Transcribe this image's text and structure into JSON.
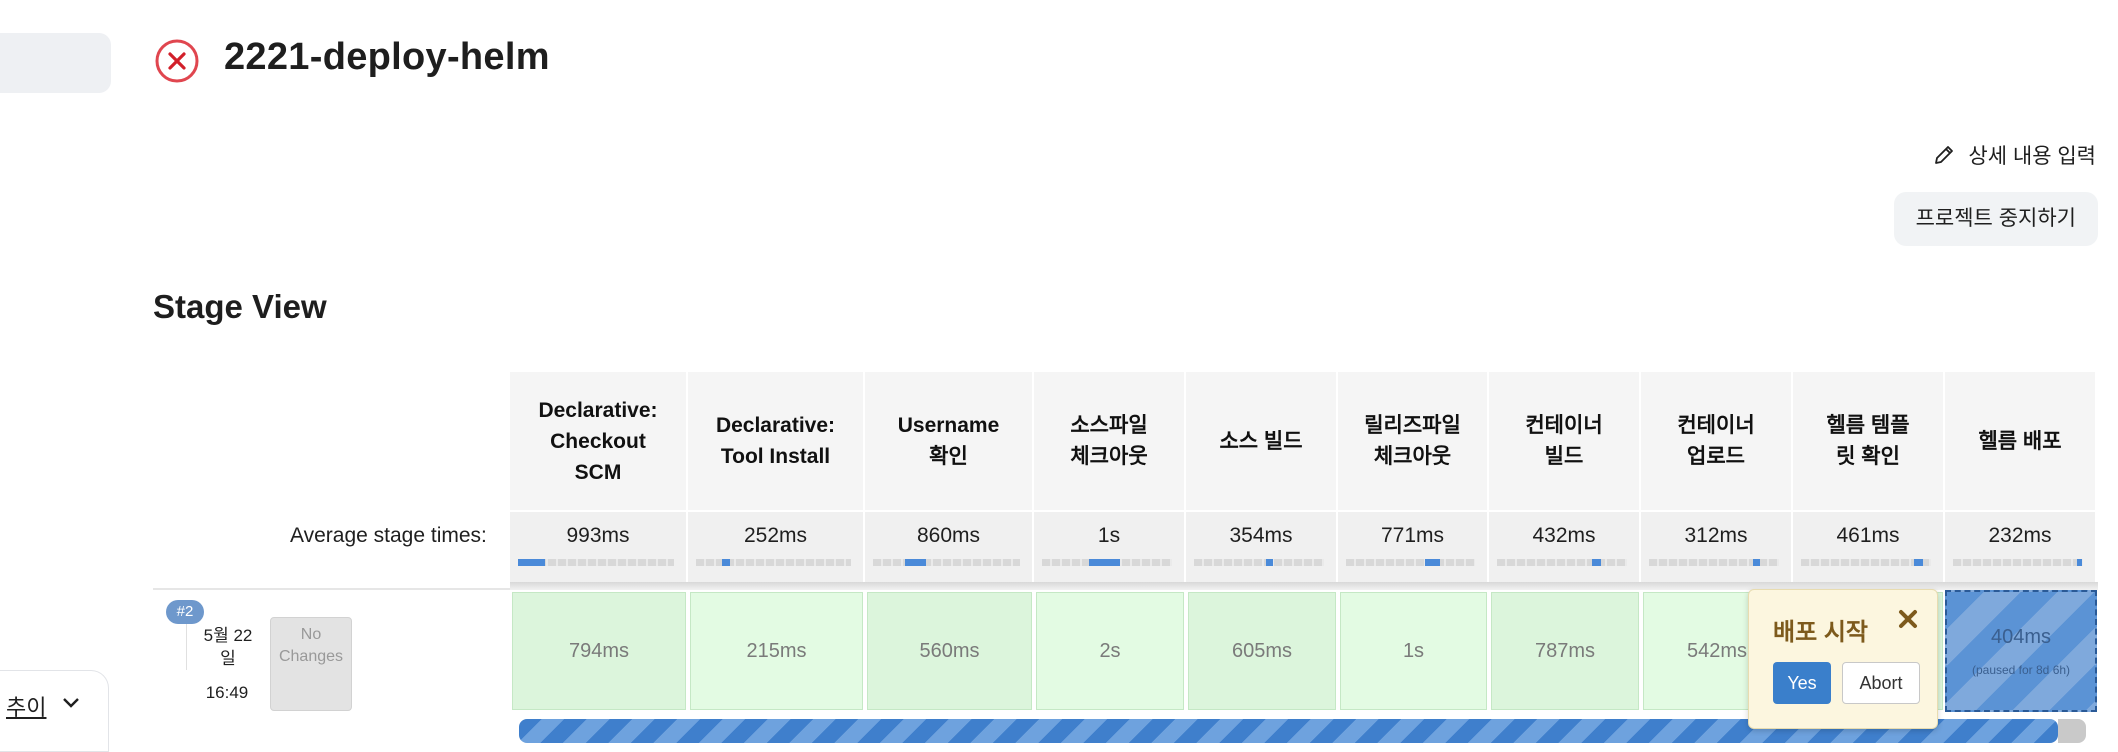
{
  "job": {
    "title": "2221-deploy-helm",
    "status": "failed",
    "status_icon": "x-circle-icon",
    "status_color": "#e0464f"
  },
  "actions": {
    "edit_description": "상세 내용 입력",
    "stop_project": "프로젝트 중지하기"
  },
  "sidebar": {
    "trend_label": "추이"
  },
  "stage_view": {
    "title": "Stage View",
    "avg_label": "Average stage times:",
    "stages": [
      {
        "name": "Declarative:\nCheckout\nSCM",
        "avg": "993ms",
        "bar_start": 0.0,
        "bar_frac": 0.17
      },
      {
        "name": "Declarative:\nTool Install",
        "avg": "252ms",
        "bar_start": 0.17,
        "bar_frac": 0.05
      },
      {
        "name": "Username\n확인",
        "avg": "860ms",
        "bar_start": 0.22,
        "bar_frac": 0.14
      },
      {
        "name": "소스파일\n체크아웃",
        "avg": "1s",
        "bar_start": 0.36,
        "bar_frac": 0.24
      },
      {
        "name": "소스 빌드",
        "avg": "354ms",
        "bar_start": 0.55,
        "bar_frac": 0.06
      },
      {
        "name": "릴리즈파일\n체크아웃",
        "avg": "771ms",
        "bar_start": 0.61,
        "bar_frac": 0.12
      },
      {
        "name": "컨테이너\n빌드",
        "avg": "432ms",
        "bar_start": 0.73,
        "bar_frac": 0.07
      },
      {
        "name": "컨테이너\n업로드",
        "avg": "312ms",
        "bar_start": 0.8,
        "bar_frac": 0.05
      },
      {
        "name": "헬름 템플\n릿 확인",
        "avg": "461ms",
        "bar_start": 0.87,
        "bar_frac": 0.07
      },
      {
        "name": "헬름 배포",
        "avg": "232ms",
        "bar_start": 0.95,
        "bar_frac": 0.04
      }
    ],
    "build": {
      "number": "#2",
      "date": "5월 22\n일",
      "time": "16:49",
      "changes": "No\nChanges",
      "progress": 0.98,
      "cells": [
        {
          "value": "794ms",
          "state": "success"
        },
        {
          "value": "215ms",
          "state": "success"
        },
        {
          "value": "560ms",
          "state": "success"
        },
        {
          "value": "2s",
          "state": "success"
        },
        {
          "value": "605ms",
          "state": "success"
        },
        {
          "value": "1s",
          "state": "success"
        },
        {
          "value": "787ms",
          "state": "success"
        },
        {
          "value": "542ms",
          "state": "success"
        },
        {
          "value": "",
          "state": "success"
        },
        {
          "value": "404ms",
          "state": "paused",
          "sub": "(paused for 8d 6h)"
        }
      ]
    }
  },
  "input_prompt": {
    "title": "배포 시작",
    "yes": "Yes",
    "abort": "Abort"
  },
  "colors": {
    "success_bg": "#dcf5dc",
    "paused_blue": "#5b93d5",
    "accent_blue": "#3a7fcb",
    "popover_bg": "#fcf6df"
  }
}
